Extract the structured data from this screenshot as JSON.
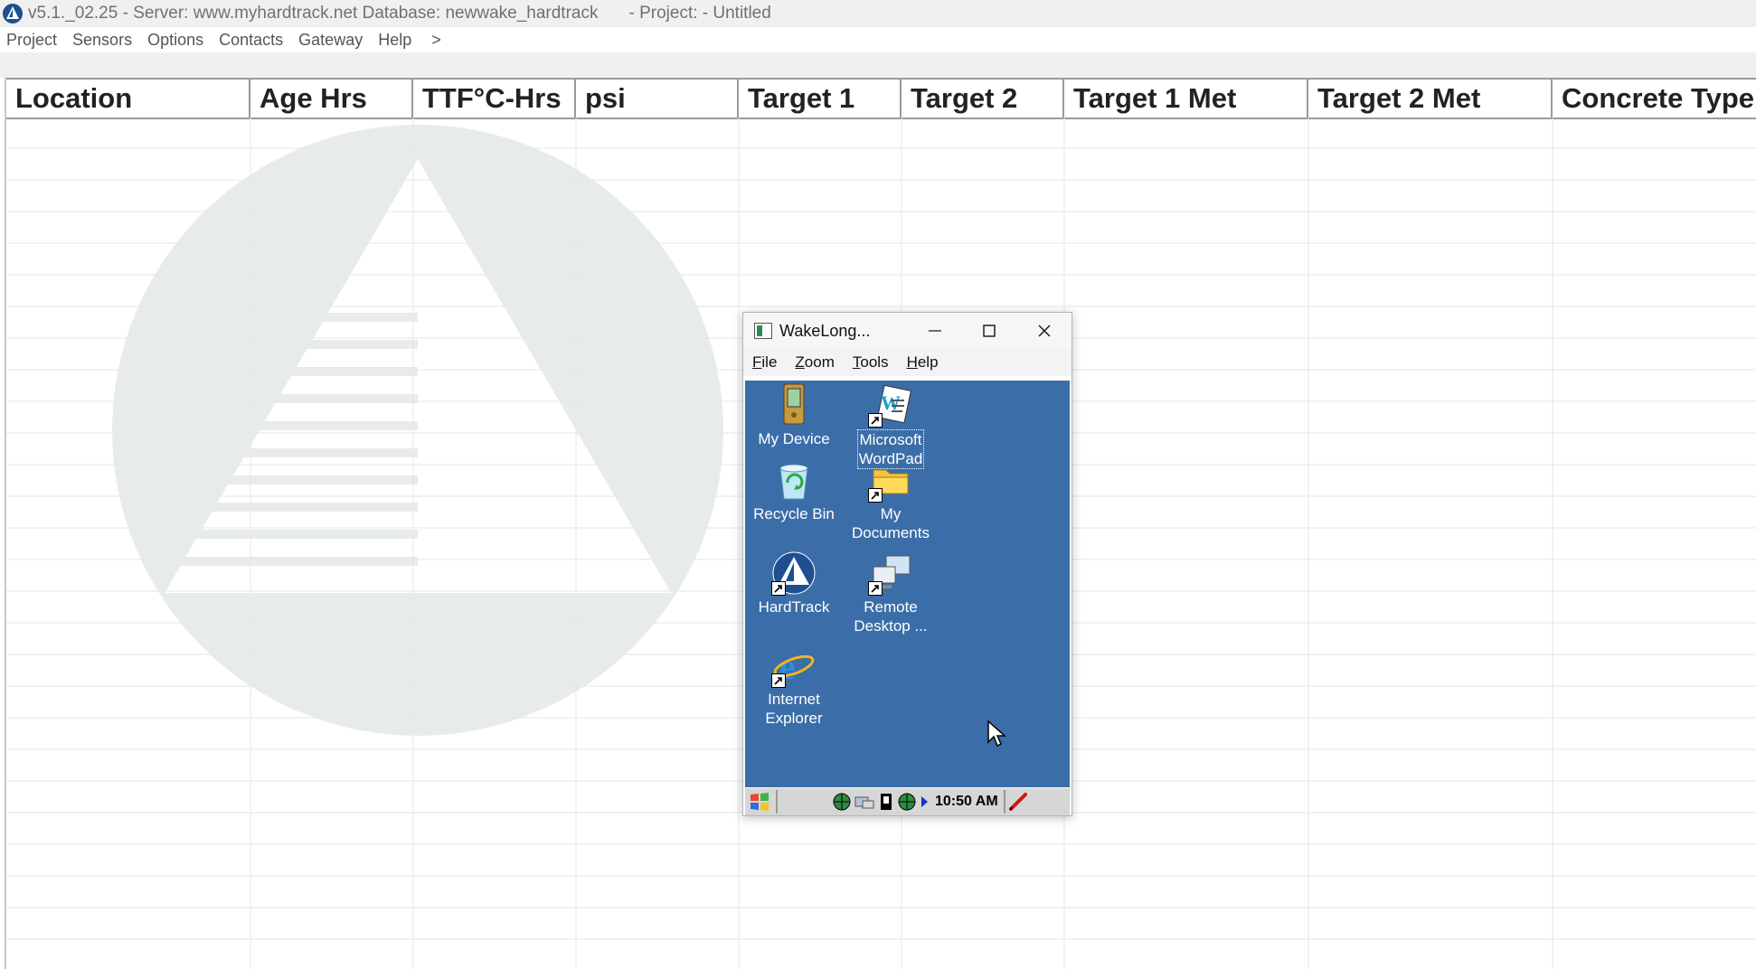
{
  "window": {
    "title_main": "v5.1._02.25 - Server: www.myhardtrack.net Database: newwake_hardtrack",
    "title_project": "- Project: - Untitled"
  },
  "menu": {
    "items": [
      "Project",
      "Sensors",
      "Options",
      "Contacts",
      "Gateway",
      "Help",
      ">"
    ]
  },
  "grid": {
    "columns": [
      "Location",
      "Age Hrs",
      "TTF°C-Hrs",
      "psi",
      "Target 1",
      "Target 2",
      "Target 1 Met",
      "Target 2 Met",
      "Concrete Type"
    ]
  },
  "emulator": {
    "title": "WakeLong...",
    "menu": [
      {
        "label": "File",
        "key": "F",
        "rest": "ile"
      },
      {
        "label": "Zoom",
        "key": "Z",
        "rest": "oom"
      },
      {
        "label": "Tools",
        "key": "T",
        "rest": "ools"
      },
      {
        "label": "Help",
        "key": "H",
        "rest": "elp"
      }
    ],
    "icons": {
      "my_device": "My Device",
      "wordpad_1": "Microsoft",
      "wordpad_2": "WordPad",
      "recycle_bin": "Recycle Bin",
      "my_documents_1": "My",
      "my_documents_2": "Documents",
      "hardtrack": "HardTrack",
      "remote_desktop_1": "Remote",
      "remote_desktop_2": "Desktop ...",
      "ie_1": "Internet",
      "ie_2": "Explorer"
    },
    "clock": "10:50 AM"
  },
  "colors": {
    "desktop": "#3b6ea8",
    "title_text": "#707070"
  }
}
